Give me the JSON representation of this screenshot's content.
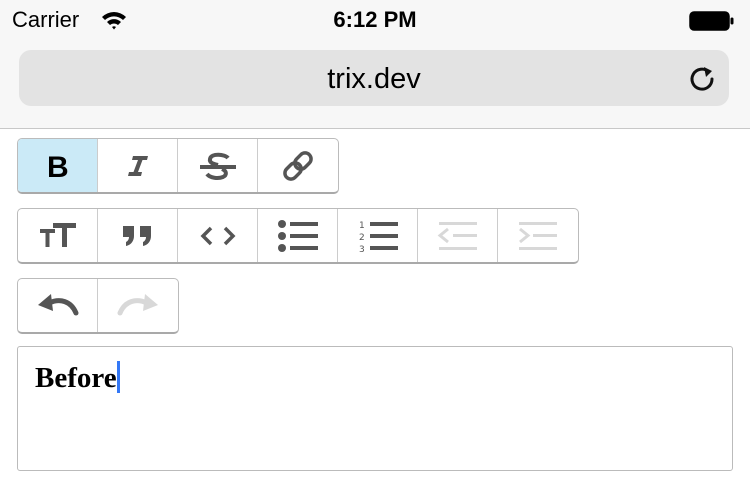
{
  "status_bar": {
    "carrier": "Carrier",
    "time": "6:12 PM",
    "icons": [
      "wifi-icon",
      "battery-icon"
    ]
  },
  "browser": {
    "url": "trix.dev",
    "reload_icon": "reload-icon"
  },
  "toolbar": {
    "text_tools": [
      {
        "name": "bold",
        "icon": "bold-icon",
        "state": "active"
      },
      {
        "name": "italic",
        "icon": "italic-icon",
        "state": "normal"
      },
      {
        "name": "strike",
        "icon": "strike-icon",
        "state": "normal"
      },
      {
        "name": "link",
        "icon": "link-icon",
        "state": "normal"
      }
    ],
    "block_tools": [
      {
        "name": "heading",
        "icon": "heading-icon",
        "state": "normal"
      },
      {
        "name": "quote",
        "icon": "quote-icon",
        "state": "normal"
      },
      {
        "name": "code",
        "icon": "code-icon",
        "state": "normal"
      },
      {
        "name": "bullet-list",
        "icon": "bullet-list-icon",
        "state": "normal"
      },
      {
        "name": "number-list",
        "icon": "number-list-icon",
        "state": "normal"
      },
      {
        "name": "decrease-nesting",
        "icon": "outdent-icon",
        "state": "disabled"
      },
      {
        "name": "increase-nesting",
        "icon": "indent-icon",
        "state": "disabled"
      }
    ],
    "history_tools": [
      {
        "name": "undo",
        "icon": "undo-icon",
        "state": "normal"
      },
      {
        "name": "redo",
        "icon": "redo-icon",
        "state": "disabled"
      }
    ]
  },
  "editor": {
    "content": "Before"
  },
  "colors": {
    "active_button": "#cbeaf7",
    "icon": "#555555",
    "icon_disabled": "#d8d8d8",
    "caret": "#3478f6"
  }
}
